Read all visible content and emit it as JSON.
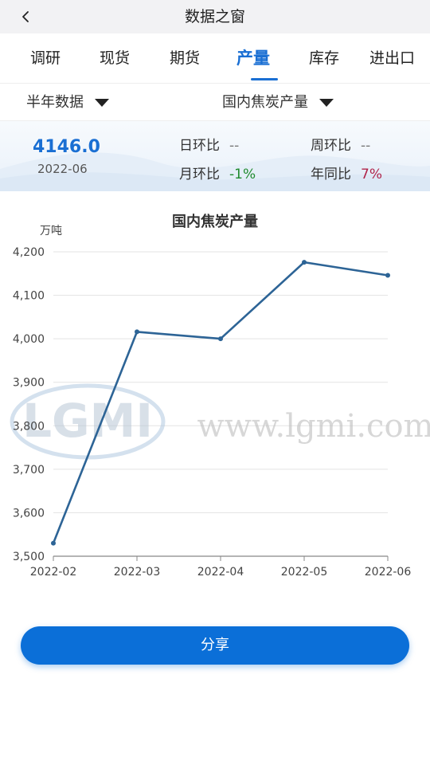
{
  "header": {
    "title": "数据之窗"
  },
  "tabs": [
    {
      "label": "调研",
      "active": false
    },
    {
      "label": "现货",
      "active": false
    },
    {
      "label": "期货",
      "active": false
    },
    {
      "label": "产量",
      "active": true
    },
    {
      "label": "库存",
      "active": false
    },
    {
      "label": "进出口",
      "active": false
    }
  ],
  "filters": {
    "period": "半年数据",
    "indicator": "国内焦炭产量"
  },
  "summary": {
    "value": "4146.0",
    "date": "2022-06",
    "day_label": "日环比",
    "day_value": "--",
    "week_label": "周环比",
    "week_value": "--",
    "month_label": "月环比",
    "month_value": "-1%",
    "year_label": "年同比",
    "year_value": "7%"
  },
  "colors": {
    "accent": "#1a6fd3",
    "line": "#2d6496",
    "positive": "#b0244a",
    "negative": "#1f8a2e"
  },
  "watermark": {
    "logo": "LGMI",
    "url": "www.lgmi.com"
  },
  "chart_data": {
    "type": "line",
    "title": "国内焦炭产量",
    "ylabel": "万吨",
    "xlabel": "",
    "categories": [
      "2022-02",
      "2022-03",
      "2022-04",
      "2022-05",
      "2022-06"
    ],
    "values": [
      3530,
      4016,
      4000,
      4176,
      4146
    ],
    "ylim": [
      3500,
      4200
    ],
    "yticks": [
      3500,
      3600,
      3700,
      3800,
      3900,
      4000,
      4100,
      4200
    ],
    "ytick_labels": [
      "3,500",
      "3,600",
      "3,700",
      "3,800",
      "3,900",
      "4,000",
      "4,100",
      "4,200"
    ],
    "grid": true
  },
  "footer": {
    "share_label": "分享"
  }
}
